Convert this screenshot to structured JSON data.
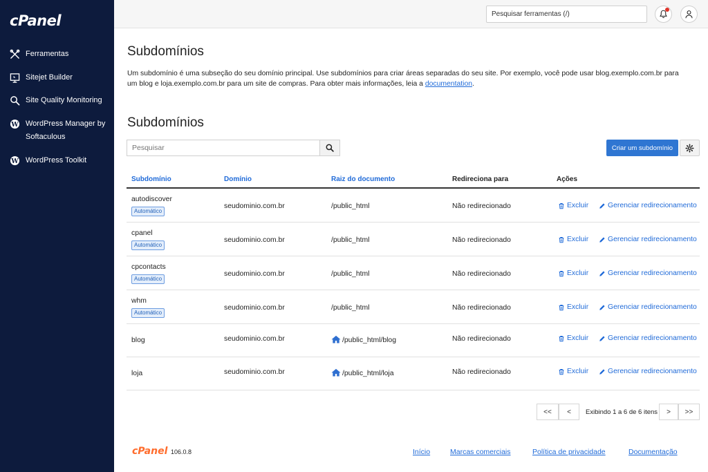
{
  "sidebar": {
    "logo": "cPanel",
    "items": [
      {
        "label": "Ferramentas",
        "icon": "tools-icon"
      },
      {
        "label": "Sitejet Builder",
        "icon": "sitejet-icon"
      },
      {
        "label": "Site Quality Monitoring",
        "icon": "magnifier-icon"
      },
      {
        "label": "WordPress Manager by Softaculous",
        "icon": "wordpress-icon"
      },
      {
        "label": "WordPress Toolkit",
        "icon": "wordpress-icon"
      }
    ]
  },
  "topbar": {
    "search_value": "Pesquisar ferramentas (/)",
    "notification_icon": "bell-icon",
    "user_icon": "user-icon"
  },
  "page": {
    "title": "Subdomínios",
    "description": "Um subdomínio é uma subseção do seu domínio principal. Use subdomínios para criar áreas separadas do seu site. Por exemplo, você pode usar blog.exemplo.com.br para um blog e loja.exemplo.com.br para um site de compras. Para obter mais informações, leia a ",
    "description_link": "documentation",
    "description_end": "."
  },
  "section": {
    "title": "Subdomínios",
    "search_placeholder": "Pesquisar",
    "create_button": "Criar um subdomínio"
  },
  "table": {
    "headers": {
      "subdomain": "Subdomínio",
      "domain": "Domínio",
      "docroot": "Raiz do documento",
      "redirect": "Redireciona para",
      "actions": "Ações"
    },
    "rows": [
      {
        "subdomain": "autodiscover",
        "badge": "Automático",
        "domain": "seudominio.com.br",
        "docroot": "/public_html",
        "redirect": "Não redirecionado",
        "delete": "Excluir",
        "manage": "Gerenciar redirecionamento"
      },
      {
        "subdomain": "cpanel",
        "badge": "Automático",
        "domain": "seudominio.com.br",
        "docroot": "/public_html",
        "redirect": "Não redirecionado",
        "delete": "Excluir",
        "manage": "Gerenciar redirecionamento"
      },
      {
        "subdomain": "cpcontacts",
        "badge": "Automático",
        "domain": "seudominio.com.br",
        "docroot": "/public_html",
        "redirect": "Não redirecionado",
        "delete": "Excluir",
        "manage": "Gerenciar redirecionamento"
      },
      {
        "subdomain": "whm",
        "badge": "Automático",
        "domain": "seudominio.com.br",
        "docroot": "/public_html",
        "redirect": "Não redirecionado",
        "delete": "Excluir",
        "manage": "Gerenciar redirecionamento"
      },
      {
        "subdomain": "blog",
        "domain": "seudominio.com.br",
        "docroot": "/public_html/blog",
        "redirect": "Não redirecionado",
        "delete": "Excluir",
        "manage": "Gerenciar redirecionamento"
      },
      {
        "subdomain": "loja",
        "domain": "seudominio.com.br",
        "docroot": "/public_html/loja",
        "redirect": "Não redirecionado",
        "delete": "Excluir",
        "manage": "Gerenciar redirecionamento"
      }
    ]
  },
  "pagination": {
    "first": "<<",
    "prev": "<",
    "info": "Exibindo 1 a 6 de 6 itens",
    "next": ">",
    "last": ">>"
  },
  "footer": {
    "logo": "cPanel",
    "version": "106.0.8",
    "links": [
      "Início",
      "Marcas comerciais",
      "Política de privacidade",
      "Documentação"
    ]
  },
  "colors": {
    "sidebar_bg": "#0d1b3d",
    "accent": "#2f76d2",
    "link": "#1f6ad8",
    "footer_logo": "#ff6c2c"
  }
}
